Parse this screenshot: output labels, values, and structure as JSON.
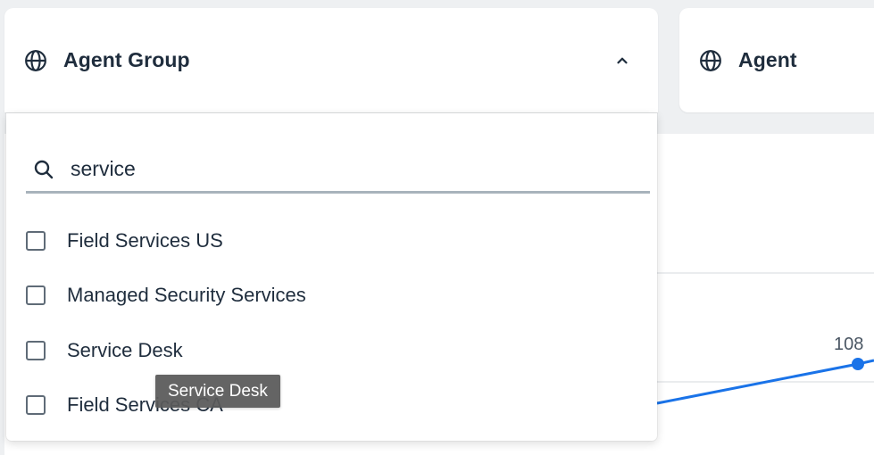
{
  "filters": {
    "agent_group": {
      "title": "Agent Group",
      "icon": "globe-icon",
      "expanded": true
    },
    "agent": {
      "title": "Agent",
      "icon": "globe-icon"
    }
  },
  "dropdown": {
    "search": {
      "value": "service",
      "icon": "search-icon"
    },
    "options": [
      {
        "label": "Field Services US",
        "checked": false
      },
      {
        "label": "Managed Security Services",
        "checked": false
      },
      {
        "label": "Service Desk",
        "checked": false
      },
      {
        "label": "Field Services CA",
        "checked": false
      }
    ]
  },
  "tooltip": {
    "text": "Service Desk"
  },
  "chart": {
    "point_label": "108",
    "line_color": "#1a73e8"
  }
}
